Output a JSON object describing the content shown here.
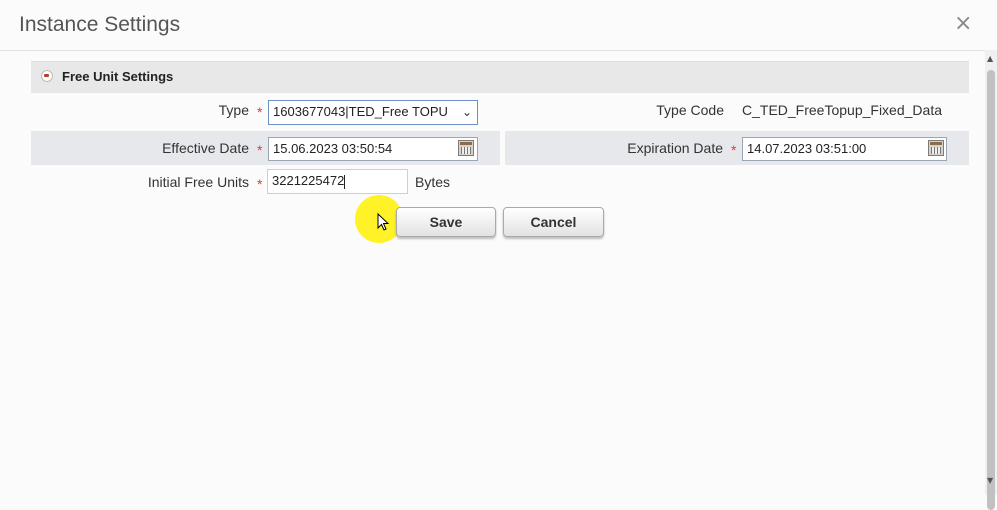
{
  "dialog": {
    "title": "Instance Settings",
    "close_glyph": "×"
  },
  "section": {
    "title": "Free Unit Settings"
  },
  "form": {
    "type": {
      "label": "Type",
      "required_mark": "*",
      "value": "1603677043|TED_Free TOPU"
    },
    "type_code": {
      "label": "Type Code",
      "value": "C_TED_FreeTopup_Fixed_Data"
    },
    "effective_date": {
      "label": "Effective Date",
      "required_mark": "*",
      "value": "15.06.2023 03:50:54"
    },
    "expiration_date": {
      "label": "Expiration Date",
      "required_mark": "*",
      "value": "14.07.2023 03:51:00"
    },
    "initial_free_units": {
      "label": "Initial Free Units",
      "required_mark": "*",
      "value": "3221225472",
      "unit": "Bytes"
    }
  },
  "buttons": {
    "save": "Save",
    "cancel": "Cancel"
  },
  "colors": {
    "band": "#e6e8ec",
    "required": "#e53935",
    "highlight": "#fff000"
  }
}
